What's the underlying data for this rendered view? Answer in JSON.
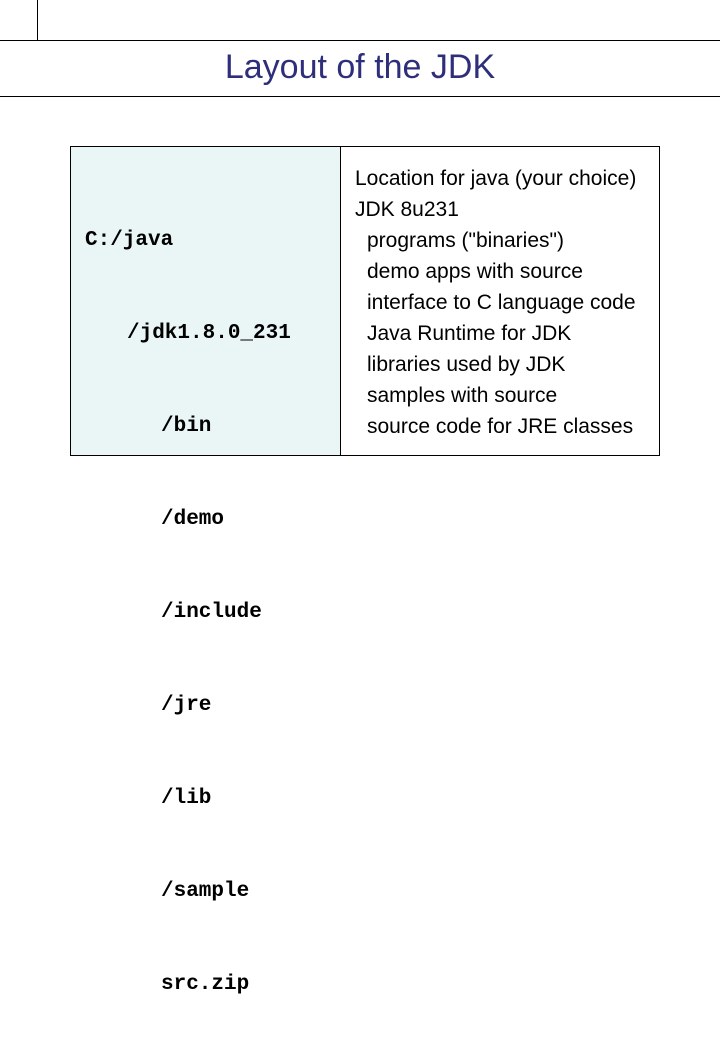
{
  "title": "Layout of the JDK",
  "paths": {
    "root": "C:/java",
    "jdk": "/jdk1.8.0_231",
    "bin": "/bin",
    "demo": "/demo",
    "include": "/include",
    "jre": "/jre",
    "lib": "/lib",
    "sample": "/sample",
    "srczip": "src.zip"
  },
  "desc": {
    "root": "Location for java (your choice)",
    "jdk": "JDK 8u231",
    "bin": "programs (\"binaries\")",
    "demo": "demo apps with source",
    "include": "interface to C language code",
    "jre": "Java Runtime for JDK",
    "lib": "libraries used by JDK",
    "sample": "samples with source",
    "srczip": "source code for JRE classes"
  }
}
